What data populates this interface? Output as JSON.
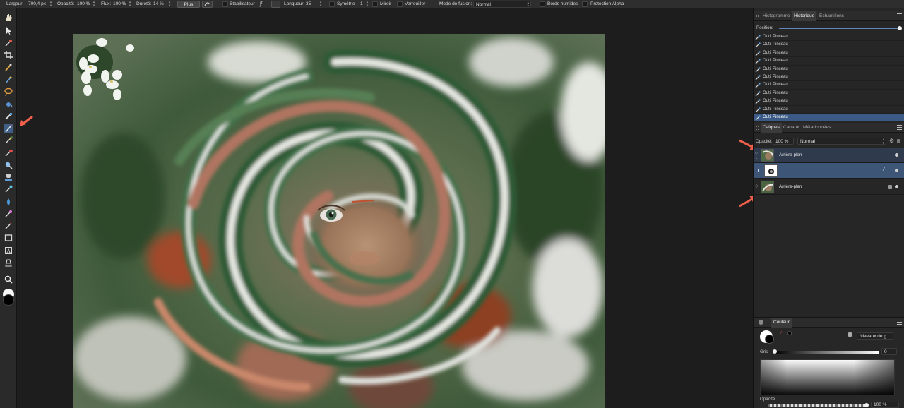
{
  "context_toolbar": {
    "width_label": "Largeur:",
    "width_value": "700,4 px",
    "opacity_label": "Opacité:",
    "opacity_value": "100 %",
    "flow_label": "Flux:",
    "flow_value": "100 %",
    "hardness_label": "Dureté:",
    "hardness_value": "14 %",
    "more_button": "Plus",
    "stabilizer_label": "Stabilisateur",
    "length_label": "Longueur:",
    "length_value": "35",
    "symmetry_label": "Symétrie",
    "symmetry_value": "1",
    "mirror_label": "Miroir",
    "lock_label": "Verrouiller",
    "blend_mode_label": "Mode de fusion:",
    "blend_mode_value": "Normal",
    "wet_edges_label": "Bords humides",
    "alpha_protect_label": "Protection Alpha"
  },
  "history_panel": {
    "tabs": [
      "Histogramme",
      "Historique",
      "Échantillons"
    ],
    "active_tab": "Historique",
    "position_label": "Position:",
    "position_fraction": 1.0,
    "entries": [
      "Outil Pinceau",
      "Outil Pinceau",
      "Outil Pinceau",
      "Outil Pinceau",
      "Outil Pinceau",
      "Outil Pinceau",
      "Outil Pinceau",
      "Outil Pinceau",
      "Outil Pinceau",
      "Outil Pinceau",
      "Outil Pinceau"
    ],
    "selected_index": 10
  },
  "layers_panel": {
    "tabs": [
      "Calques",
      "Canaux",
      "Métadonnées"
    ],
    "active_tab": "Calques",
    "opacity_label": "Opacité:",
    "opacity_value": "100 %",
    "blend_mode": "Normal",
    "layers": [
      {
        "name": "Arrière-plan",
        "kind": "group"
      },
      {
        "name": "",
        "kind": "mask",
        "selected": true
      },
      {
        "name": "Arrière-plan",
        "kind": "pixel",
        "locked": true
      }
    ]
  },
  "color_panel": {
    "tab": "Couleur",
    "mode_value": "Niveaux de g...",
    "gray_label": "Gris",
    "gray_value": "0",
    "opacity_label": "Opacité",
    "opacity_value": "100 %"
  },
  "colors": {
    "accent": "#3b5a85",
    "annotation_arrow": "#f0604a"
  }
}
